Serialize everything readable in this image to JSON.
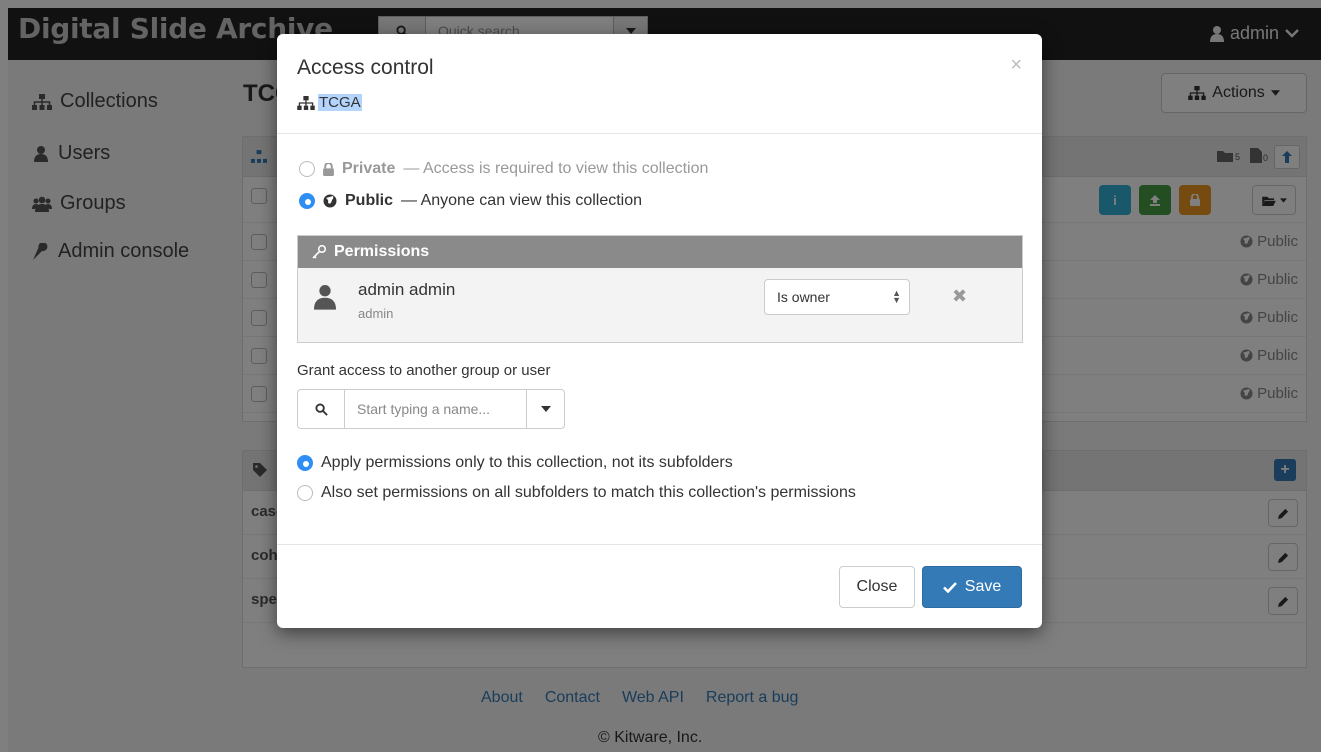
{
  "app": {
    "brand": "Digital Slide Archive",
    "user": "admin"
  },
  "search": {
    "placeholder": "Quick search..."
  },
  "sidebar": {
    "items": [
      {
        "label": "Collections",
        "icon": "sitemap-icon"
      },
      {
        "label": "Users",
        "icon": "user-icon"
      },
      {
        "label": "Groups",
        "icon": "users-icon"
      },
      {
        "label": "Admin console",
        "icon": "wrench-icon"
      }
    ]
  },
  "main": {
    "title": "TCGA",
    "actions_label": "Actions",
    "folder_count": "5",
    "item_count": "0",
    "rows": [
      {
        "access": "Public"
      },
      {
        "access": "Public"
      },
      {
        "access": "Public"
      },
      {
        "access": "Public"
      },
      {
        "access": "Public"
      }
    ],
    "metadata": [
      {
        "key": "case_count"
      },
      {
        "key": "cohort"
      },
      {
        "key": "specimenCount"
      }
    ]
  },
  "footer": {
    "links": [
      "About",
      "Contact",
      "Web API",
      "Report a bug"
    ],
    "copyright": "© Kitware, Inc."
  },
  "modal": {
    "title": "Access control",
    "subject": "TCGA",
    "private": {
      "label": "Private",
      "desc": "— Access is required to view this collection"
    },
    "public": {
      "label": "Public",
      "desc": "— Anyone can view this collection",
      "selected": true
    },
    "permissions_header": "Permissions",
    "entry": {
      "name": "admin admin",
      "login": "admin",
      "level": "Is owner"
    },
    "grant_label": "Grant access to another group or user",
    "grant_placeholder": "Start typing a name...",
    "recurse": {
      "option_only": "Apply permissions only to this collection, not its subfolders",
      "option_all": "Also set permissions on all subfolders to match this collection's permissions",
      "selected": "option_only"
    },
    "close_label": "Close",
    "save_label": "Save",
    "colors": {
      "primary": "#337ab7",
      "radio": "#2f8ef4",
      "perm_header": "#8a8a8a"
    }
  }
}
